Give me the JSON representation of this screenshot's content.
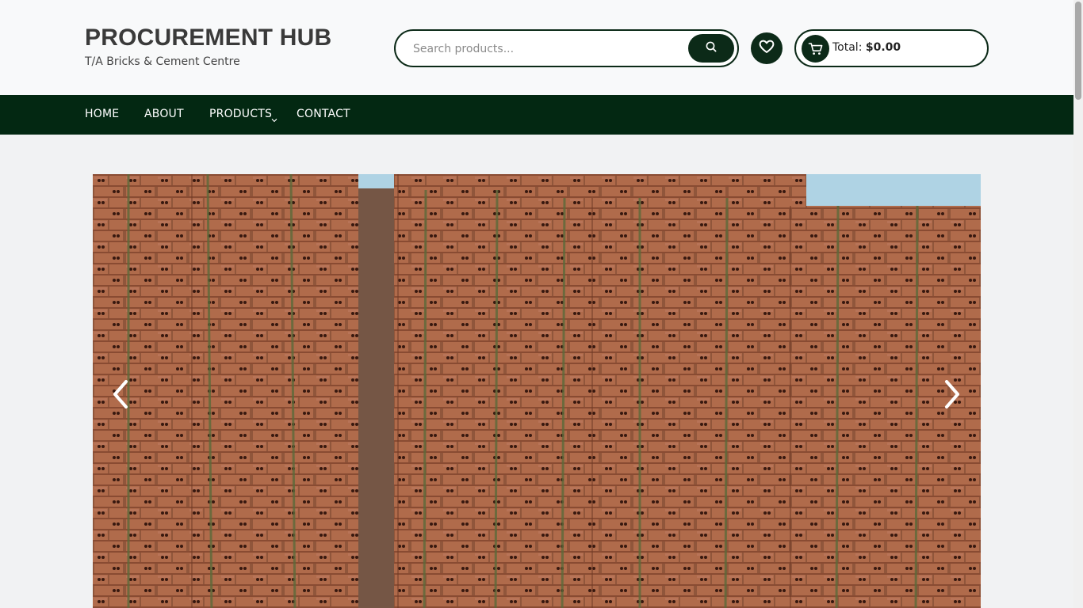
{
  "brand": {
    "title": "PROCUREMENT HUB",
    "subtitle": "T/A Bricks & Cement Centre"
  },
  "search": {
    "placeholder": "Search products...",
    "value": "",
    "icon": "search-icon"
  },
  "wishlist": {
    "icon": "heart-icon"
  },
  "cart": {
    "icon": "cart-icon",
    "label": "Total:",
    "amount": "$0.00"
  },
  "nav": {
    "items": [
      {
        "label": "HOME"
      },
      {
        "label": "ABOUT"
      },
      {
        "label": "PRODUCTS",
        "has_dropdown": true
      },
      {
        "label": "CONTACT"
      }
    ]
  },
  "slider": {
    "image": "stacked-red-clay-bricks-photo",
    "prev_icon": "chevron-left-icon",
    "next_icon": "chevron-right-icon"
  },
  "colors": {
    "brand_dark": "#032812",
    "accent": "#0c2a18",
    "header_bg": "#f8f9fa",
    "page_bg": "#f1f2f3",
    "brick": "#b66a4b"
  }
}
